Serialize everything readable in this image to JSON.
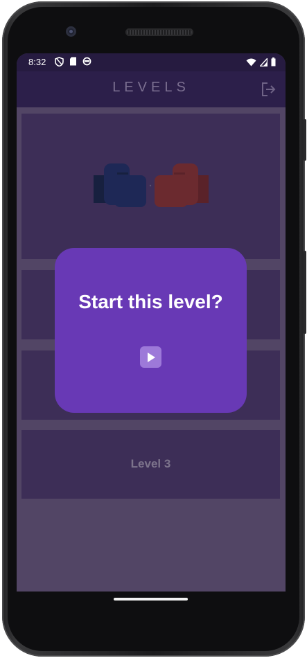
{
  "status_bar": {
    "time": "8:32",
    "left_icons": [
      "shield-icon",
      "sd-card-icon",
      "sync-icon"
    ],
    "right_icons": [
      "wifi-icon",
      "signal-icon",
      "battery-icon"
    ]
  },
  "appbar": {
    "title": "LEVELS",
    "logout_icon": "logout-icon"
  },
  "levels": [
    {
      "label": "",
      "image": "boxing-gloves"
    },
    {
      "label": ""
    },
    {
      "label": ""
    },
    {
      "label": "Level 3"
    }
  ],
  "dialog": {
    "title": "Start this level?",
    "play_icon": "play-icon"
  },
  "colors": {
    "appbar": "#2c1f4a",
    "status_bar": "#261b40",
    "dialog": "#6839b5",
    "card": "#3d2e57",
    "background": "#524565",
    "glove_blue": "#1e2856",
    "glove_red": "#6b2a2f"
  }
}
